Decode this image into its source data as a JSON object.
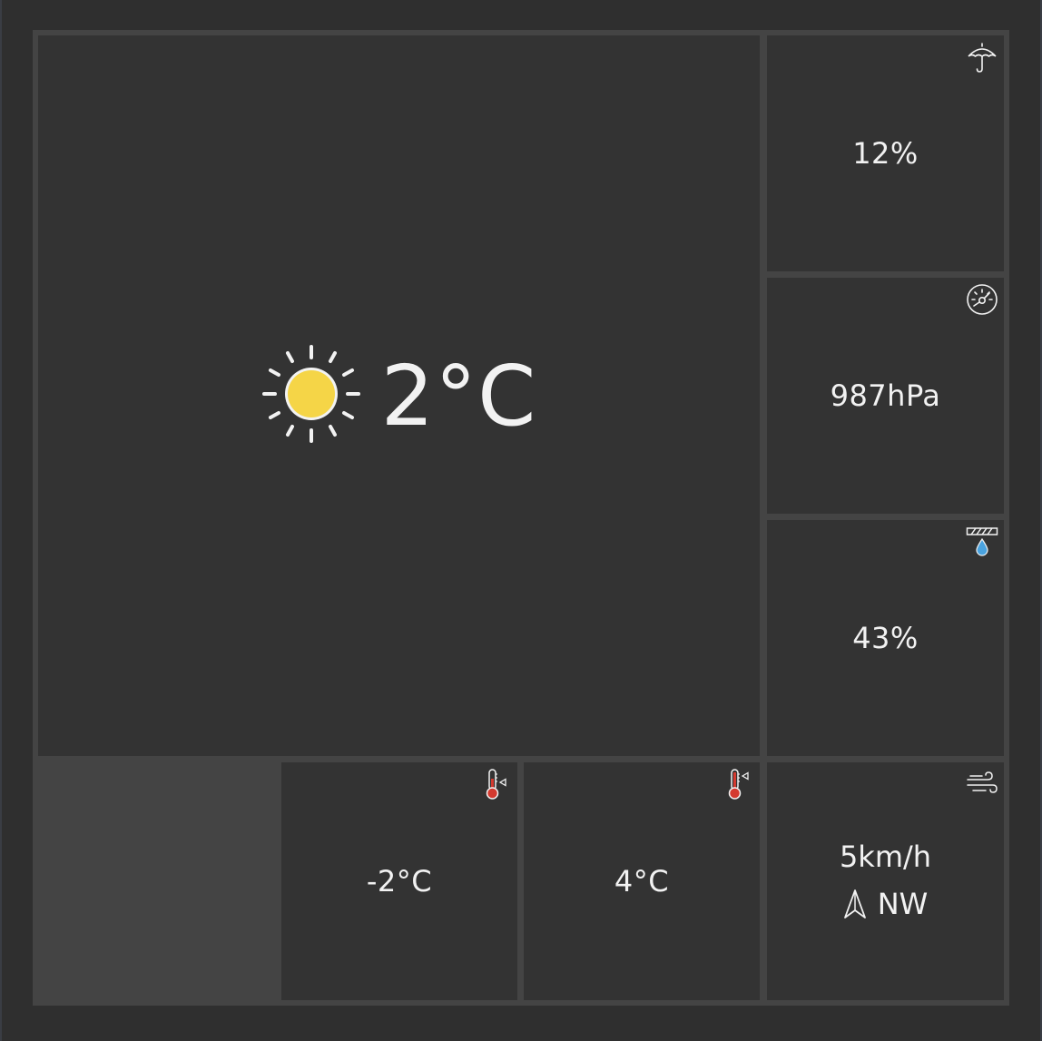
{
  "current": {
    "temperature": "2°C",
    "condition_icon": "sun-icon",
    "sun_color": "#f5d547"
  },
  "precipitation": {
    "value": "12%",
    "icon": "umbrella-icon"
  },
  "pressure": {
    "value": "987hPa",
    "icon": "barometer-icon"
  },
  "humidity": {
    "value": "43%",
    "icon": "humidity-drop-icon",
    "drop_color": "#4aa3df"
  },
  "temp_min": {
    "value": "-2°C",
    "icon": "thermometer-low-icon",
    "bulb_color": "#d43a2f"
  },
  "temp_max": {
    "value": "4°C",
    "icon": "thermometer-high-icon",
    "bulb_color": "#d43a2f"
  },
  "wind": {
    "speed": "5km/h",
    "direction": "NW",
    "icon": "wind-icon",
    "arrow_icon": "direction-arrow-icon"
  }
}
